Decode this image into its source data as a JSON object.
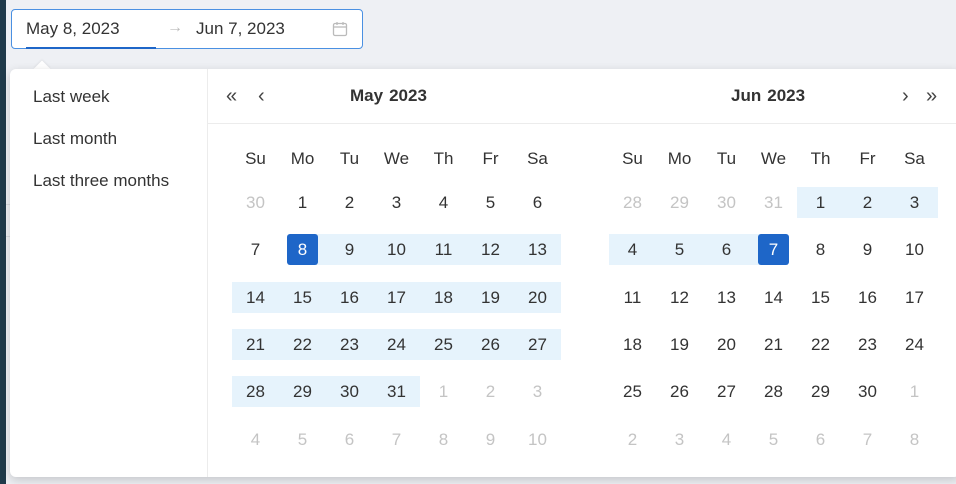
{
  "range": {
    "start": "May 8, 2023",
    "separator": "→",
    "end": "Jun 7, 2023"
  },
  "presets": [
    {
      "label": "Last week"
    },
    {
      "label": "Last month"
    },
    {
      "label": "Last three months"
    }
  ],
  "nav": {
    "prev_year": "«",
    "prev_month": "‹",
    "next_month": "›",
    "next_year": "»"
  },
  "weekdays": [
    "Su",
    "Mo",
    "Tu",
    "We",
    "Th",
    "Fr",
    "Sa"
  ],
  "calendars": [
    {
      "month": "May",
      "year": "2023",
      "days": [
        [
          "30",
          "1",
          "2",
          "3",
          "4",
          "5",
          "6"
        ],
        [
          "7",
          "8",
          "9",
          "10",
          "11",
          "12",
          "13"
        ],
        [
          "14",
          "15",
          "16",
          "17",
          "18",
          "19",
          "20"
        ],
        [
          "21",
          "22",
          "23",
          "24",
          "25",
          "26",
          "27"
        ],
        [
          "28",
          "29",
          "30",
          "31",
          "1",
          "2",
          "3"
        ],
        [
          "4",
          "5",
          "6",
          "7",
          "8",
          "9",
          "10"
        ]
      ]
    },
    {
      "month": "Jun",
      "year": "2023",
      "days": [
        [
          "28",
          "29",
          "30",
          "31",
          "1",
          "2",
          "3"
        ],
        [
          "4",
          "5",
          "6",
          "7",
          "8",
          "9",
          "10"
        ],
        [
          "11",
          "12",
          "13",
          "14",
          "15",
          "16",
          "17"
        ],
        [
          "18",
          "19",
          "20",
          "21",
          "22",
          "23",
          "24"
        ],
        [
          "25",
          "26",
          "27",
          "28",
          "29",
          "30",
          "1"
        ],
        [
          "2",
          "3",
          "4",
          "5",
          "6",
          "7",
          "8"
        ]
      ]
    }
  ],
  "colors": {
    "accent": "#1e66c8",
    "range_bg": "#e6f3fc",
    "muted_text": "#c4c4c4"
  }
}
